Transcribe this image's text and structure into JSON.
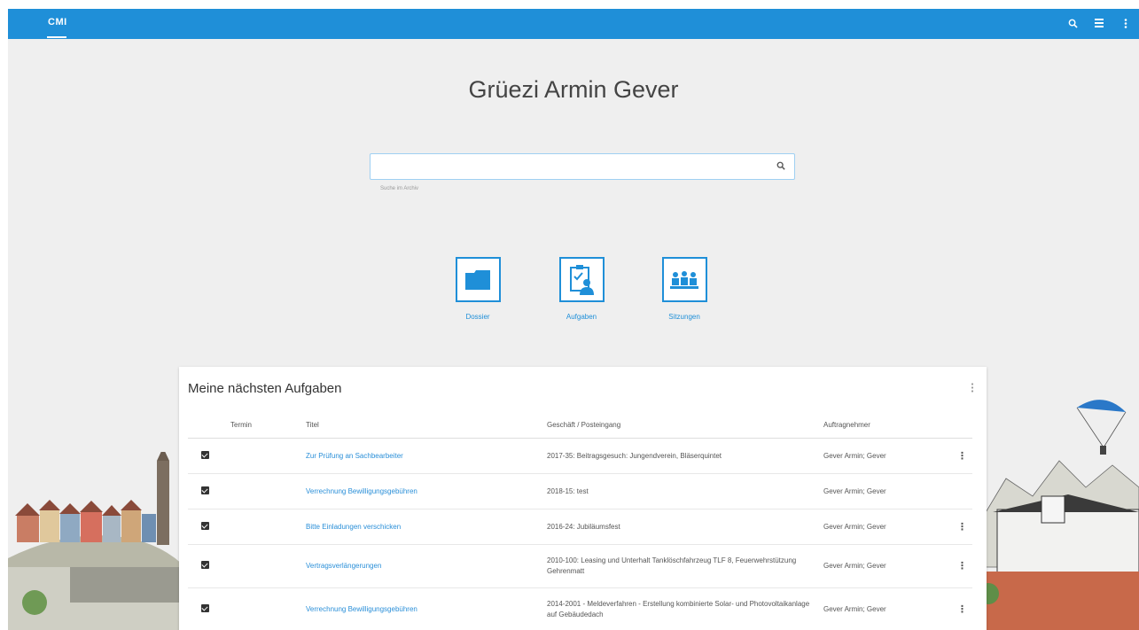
{
  "topbar": {
    "brand": "CMI",
    "icons": [
      "search-icon",
      "apps-icon",
      "more-vert-icon"
    ]
  },
  "greeting": "Grüezi Armin Gever",
  "search": {
    "value": "",
    "hint": "Suche im Archiv"
  },
  "tiles": [
    {
      "label": "Dossier",
      "icon": "folder-icon"
    },
    {
      "label": "Aufgaben",
      "icon": "task-clipboard-icon"
    },
    {
      "label": "Sitzungen",
      "icon": "meeting-people-icon"
    }
  ],
  "tasks": {
    "title": "Meine nächsten Aufgaben",
    "columns": {
      "termin": "Termin",
      "titel": "Titel",
      "geschaeft": "Geschäft / Posteingang",
      "auftragnehmer": "Auftragnehmer"
    },
    "rows": [
      {
        "titel": "Zur Prüfung an Sachbearbeiter",
        "geschaeft": "2017-35: Beitragsgesuch: Jungendverein, Bläserquintet",
        "auftragnehmer": "Gever Armin; Gever",
        "menu": true
      },
      {
        "titel": "Verrechnung Bewilligungsgebühren",
        "geschaeft": "2018-15: test",
        "auftragnehmer": "Gever Armin; Gever",
        "menu": false
      },
      {
        "titel": "Bitte Einladungen verschicken",
        "geschaeft": "2016-24: Jubiläumsfest",
        "auftragnehmer": "Gever Armin; Gever",
        "menu": true
      },
      {
        "titel": "Vertragsverlängerungen",
        "geschaeft": "2010-100: Leasing und Unterhalt Tanklöschfahrzeug TLF 8, Feuerwehrstützung Gehrenmatt",
        "auftragnehmer": "Gever Armin; Gever",
        "menu": true
      },
      {
        "titel": "Verrechnung Bewilligungsgebühren",
        "geschaeft": "2014-2001 - Meldeverfahren - Erstellung kombinierte Solar- und Photovoltaikanlage auf Gebäudedach",
        "auftragnehmer": "Gever Armin; Gever",
        "menu": true
      }
    ]
  },
  "colors": {
    "accent": "#1f8fd8",
    "background": "#efefef"
  }
}
